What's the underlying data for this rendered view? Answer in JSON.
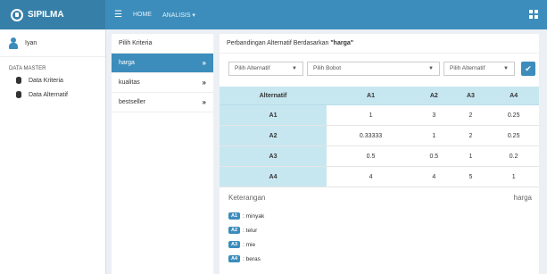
{
  "header": {
    "brand": "SIPILMA",
    "nav": [
      "HOME",
      "ANALISIS ▾"
    ]
  },
  "sidebar": {
    "user": "Iyan",
    "section": "DATA MASTER",
    "items": [
      "Data Kriteria",
      "Data Alternatif"
    ]
  },
  "criteria_panel": {
    "title": "Pilih Kriteria",
    "items": [
      {
        "label": "harga",
        "chevron": "»"
      },
      {
        "label": "kualitas",
        "chevron": "»"
      },
      {
        "label": "bestseller",
        "chevron": "»"
      }
    ]
  },
  "main": {
    "title_prefix": "Perbandingan Alternatif Berdasarkan ",
    "title_criterion": "\"harga\"",
    "selects": {
      "alt1": "Pilih Alternatif",
      "bobot": "Pilih Bobot",
      "alt2": "Pilih Alternatif"
    },
    "ok_label": "✔"
  },
  "matrix": {
    "headers": [
      "Alternatif",
      "A1",
      "A2",
      "A3",
      "A4"
    ],
    "rows": [
      {
        "label": "A1",
        "values": [
          "1",
          "3",
          "2",
          "0.25"
        ]
      },
      {
        "label": "A2",
        "values": [
          "0.33333",
          "1",
          "2",
          "0.25"
        ]
      },
      {
        "label": "A3",
        "values": [
          "0.5",
          "0.5",
          "1",
          "0.2"
        ]
      },
      {
        "label": "A4",
        "values": [
          "4",
          "4",
          "5",
          "1"
        ]
      }
    ]
  },
  "legend": {
    "title": "Keterangan",
    "criterion": "harga",
    "items": [
      {
        "code": "A1",
        "name": ": minyak"
      },
      {
        "code": "A2",
        "name": ": telur"
      },
      {
        "code": "A3",
        "name": ": mie"
      },
      {
        "code": "A4",
        "name": ": beras"
      }
    ]
  }
}
